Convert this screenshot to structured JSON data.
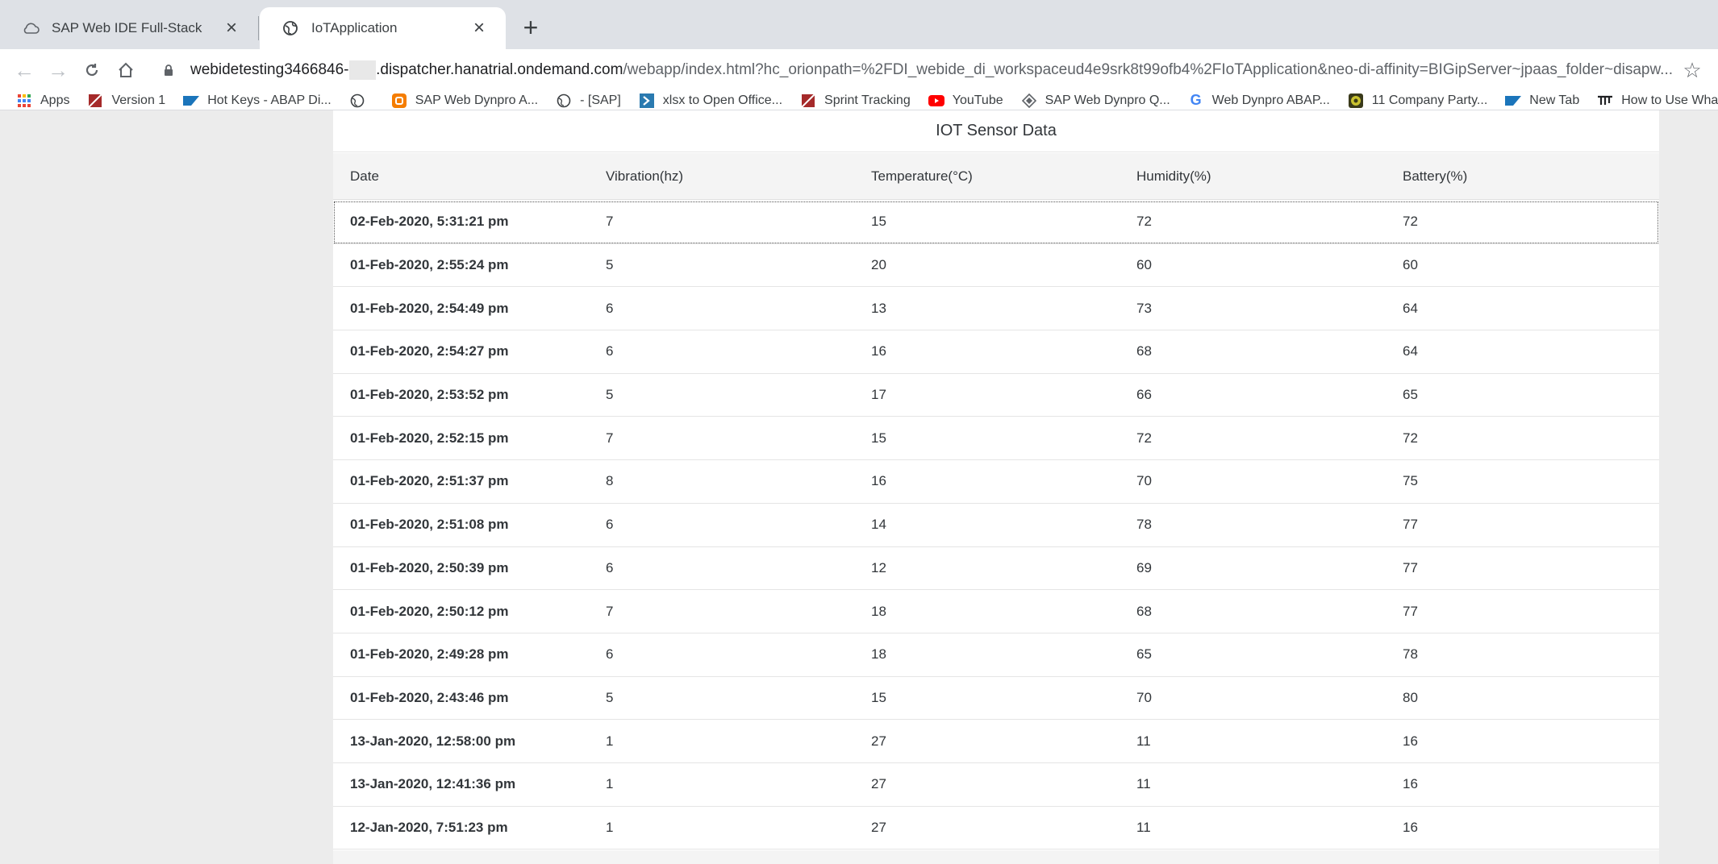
{
  "browser": {
    "tabs": [
      {
        "title": "SAP Web IDE Full-Stack",
        "icon": "cloud-icon",
        "active": false
      },
      {
        "title": "IoTApplication",
        "icon": "globe-icon",
        "active": true
      }
    ],
    "new_tab": "+",
    "url": {
      "host_start": "webidetesting3466846-",
      "host_end": ".dispatcher.hanatrial.ondemand.com",
      "path": "/webapp/index.html?hc_orionpath=%2FDI_webide_di_workspaceud4e9srk8t99ofb4%2FIoTApplication&neo-di-affinity=BIGipServer~jpaas_folder~disapw..."
    },
    "bookmarks": [
      {
        "label": "Apps",
        "icon": "apps-grid-icon"
      },
      {
        "label": "Version 1",
        "icon": "page-icon"
      },
      {
        "label": "Hot Keys - ABAP Di...",
        "icon": "sap-logo-icon"
      },
      {
        "label": "",
        "icon": "globe-icon"
      },
      {
        "label": "SAP Web Dynpro A...",
        "icon": "blogger-icon"
      },
      {
        "label": "- [SAP]",
        "icon": "globe-icon"
      },
      {
        "label": "xlsx to Open Office...",
        "icon": "arrow-box-icon"
      },
      {
        "label": "Sprint Tracking",
        "icon": "page-icon"
      },
      {
        "label": "YouTube",
        "icon": "youtube-icon"
      },
      {
        "label": "SAP Web Dynpro Q...",
        "icon": "diamond-icon"
      },
      {
        "label": "Web Dynpro ABAP...",
        "icon": "google-icon"
      },
      {
        "label": "11 Company Party...",
        "icon": "badge-icon"
      },
      {
        "label": "New Tab",
        "icon": "sap-logo-icon"
      },
      {
        "label": "How to Use Whats...",
        "icon": "hindi-icon"
      }
    ]
  },
  "table": {
    "title": "IOT Sensor Data",
    "headers": [
      "Date",
      "Vibration(hz)",
      "Temperature(°C)",
      "Humidity(%)",
      "Battery(%)"
    ],
    "rows": [
      [
        "02-Feb-2020, 5:31:21 pm",
        "7",
        "15",
        "72",
        "72"
      ],
      [
        "01-Feb-2020, 2:55:24 pm",
        "5",
        "20",
        "60",
        "60"
      ],
      [
        "01-Feb-2020, 2:54:49 pm",
        "6",
        "13",
        "73",
        "64"
      ],
      [
        "01-Feb-2020, 2:54:27 pm",
        "6",
        "16",
        "68",
        "64"
      ],
      [
        "01-Feb-2020, 2:53:52 pm",
        "5",
        "17",
        "66",
        "65"
      ],
      [
        "01-Feb-2020, 2:52:15 pm",
        "7",
        "15",
        "72",
        "72"
      ],
      [
        "01-Feb-2020, 2:51:37 pm",
        "8",
        "16",
        "70",
        "75"
      ],
      [
        "01-Feb-2020, 2:51:08 pm",
        "6",
        "14",
        "78",
        "77"
      ],
      [
        "01-Feb-2020, 2:50:39 pm",
        "6",
        "12",
        "69",
        "77"
      ],
      [
        "01-Feb-2020, 2:50:12 pm",
        "7",
        "18",
        "68",
        "77"
      ],
      [
        "01-Feb-2020, 2:49:28 pm",
        "6",
        "18",
        "65",
        "78"
      ],
      [
        "01-Feb-2020, 2:43:46 pm",
        "5",
        "15",
        "70",
        "80"
      ],
      [
        "13-Jan-2020, 12:58:00 pm",
        "1",
        "27",
        "11",
        "16"
      ],
      [
        "13-Jan-2020, 12:41:36 pm",
        "1",
        "27",
        "11",
        "16"
      ],
      [
        "12-Jan-2020, 7:51:23 pm",
        "1",
        "27",
        "11",
        "16"
      ]
    ]
  }
}
